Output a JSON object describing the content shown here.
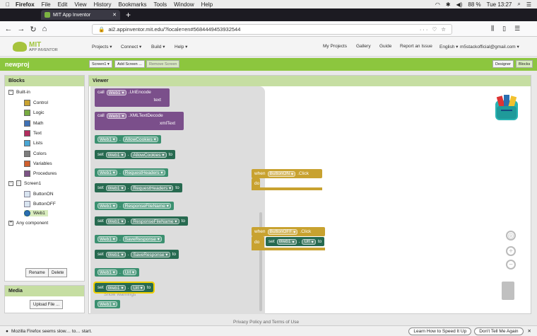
{
  "mac_menubar": {
    "app": "Firefox",
    "items": [
      "File",
      "Edit",
      "View",
      "History",
      "Bookmarks",
      "Tools",
      "Window",
      "Help"
    ],
    "battery": "88 %",
    "clock": "Tue 13:27"
  },
  "browser": {
    "tab_title": "MIT App Inventor",
    "url": "ai2.appinventor.mit.edu/?locale=en#5684449453932544",
    "url_actions": "··· ♡ ☆"
  },
  "app_header": {
    "logo_line1": "MIT",
    "logo_line2": "APP INVENTOR",
    "menus": [
      "Projects ▾",
      "Connect ▾",
      "Build ▾",
      "Help ▾"
    ],
    "right_links": [
      "My Projects",
      "Gallery",
      "Guide",
      "Report an Issue",
      "English ▾",
      "m5stackofficial@gmail.com ▾"
    ]
  },
  "project_bar": {
    "name": "newproj",
    "screen_select": "Screen1 ▾",
    "add_screen": "Add Screen ...",
    "remove_screen": "Remove Screen",
    "designer": "Designer",
    "blocks": "Blocks"
  },
  "blocks_panel": {
    "title": "Blocks",
    "builtin_label": "Built-in",
    "builtin": [
      {
        "label": "Control",
        "color": "#c8a230"
      },
      {
        "label": "Logic",
        "color": "#77ab41"
      },
      {
        "label": "Math",
        "color": "#3f71b5"
      },
      {
        "label": "Text",
        "color": "#b32d5e"
      },
      {
        "label": "Lists",
        "color": "#49a6d4"
      },
      {
        "label": "Colors",
        "color": "#7d7d7d"
      },
      {
        "label": "Variables",
        "color": "#d05f2d"
      },
      {
        "label": "Procedures",
        "color": "#7c5385"
      }
    ],
    "screen_label": "Screen1",
    "components": [
      "ButtonON",
      "ButtonOFF",
      "Web1"
    ],
    "any_component": "Any component",
    "rename": "Rename",
    "delete": "Delete"
  },
  "media_panel": {
    "title": "Media",
    "upload": "Upload File ..."
  },
  "viewer": {
    "title": "Viewer",
    "flyout": [
      {
        "type": "call",
        "comp": "Web1",
        "method": ".UriEncode",
        "arg": "text"
      },
      {
        "type": "call",
        "comp": "Web1",
        "method": ".XMLTextDecode",
        "arg": "xmlText"
      },
      {
        "type": "get",
        "comp": "Web1",
        "prop": "AllowCookies"
      },
      {
        "type": "set",
        "comp": "Web1",
        "prop": "AllowCookies"
      },
      {
        "type": "get",
        "comp": "Web1",
        "prop": "RequestHeaders"
      },
      {
        "type": "set",
        "comp": "Web1",
        "prop": "RequestHeaders"
      },
      {
        "type": "get",
        "comp": "Web1",
        "prop": "ResponseFileName"
      },
      {
        "type": "set",
        "comp": "Web1",
        "prop": "ResponseFileName"
      },
      {
        "type": "get",
        "comp": "Web1",
        "prop": "SaveResponse"
      },
      {
        "type": "set",
        "comp": "Web1",
        "prop": "SaveResponse"
      },
      {
        "type": "get",
        "comp": "Web1",
        "prop": "Url"
      },
      {
        "type": "set",
        "comp": "Web1",
        "prop": "Url"
      },
      {
        "type": "comp",
        "comp": "Web1"
      }
    ],
    "words": {
      "call": "call",
      "set": "set",
      "to": "to",
      "when": "when",
      "do": "do"
    },
    "event1": {
      "comp": "ButtonON",
      "event": ".Click"
    },
    "event2": {
      "comp": "ButtonOFF",
      "event": ".Click",
      "set_comp": "Web1",
      "set_prop": "Url"
    },
    "show_warnings": "Show Warnings"
  },
  "footer": "Privacy Policy and Terms of Use",
  "statusbar": {
    "message": "Mozilla Firefox seems slow… to… start.",
    "btn1": "Learn How to Speed It Up",
    "btn2": "Don't Tell Me Again"
  }
}
